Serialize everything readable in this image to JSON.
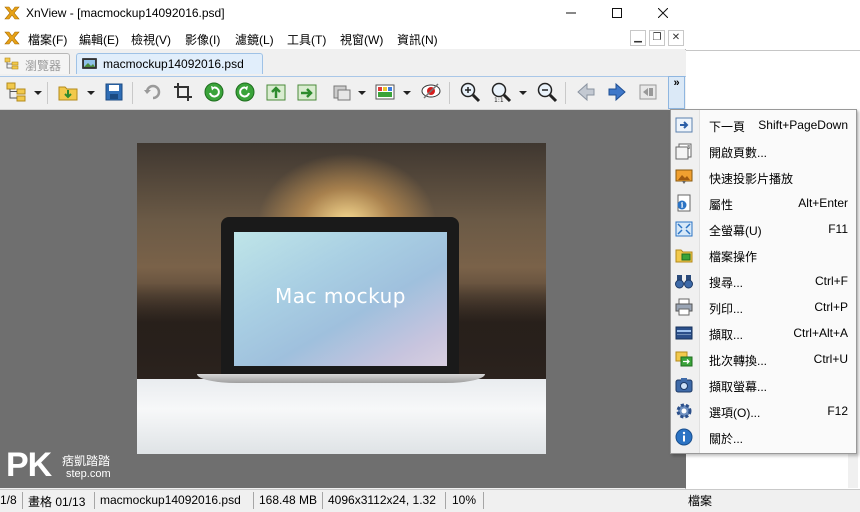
{
  "window": {
    "title": "XnView - [macmockup14092016.psd]"
  },
  "menubar": {
    "items": [
      "檔案(F)",
      "編輯(E)",
      "檢視(V)",
      "影像(I)",
      "濾鏡(L)",
      "工具(T)",
      "視窗(W)",
      "資訊(N)"
    ]
  },
  "tabs": [
    {
      "label": "瀏覽器"
    },
    {
      "label": "macmockup14092016.psd"
    }
  ],
  "image": {
    "screen_text": "Mac mockup"
  },
  "watermark": {
    "logo": "PK",
    "cn": "痞凱踏踏",
    "site": "step.com"
  },
  "statusbar": {
    "page": "1/8",
    "frame": "畫格 01/13",
    "filename": "macmockup14092016.psd",
    "size": "168.48 MB",
    "dims": "4096x3112x24, 1.32",
    "zoom": "10%"
  },
  "background_window": {
    "status": "檔案"
  },
  "dropdown_menu": {
    "items": [
      {
        "label": "下一頁",
        "shortcut": "Shift+PageDown",
        "icon": "next-page-icon"
      },
      {
        "label": "開啟頁數...",
        "shortcut": "",
        "icon": "open-pages-icon"
      },
      {
        "label": "快速投影片播放",
        "shortcut": "",
        "icon": "slideshow-icon"
      },
      {
        "label": "屬性",
        "shortcut": "Alt+Enter",
        "icon": "properties-icon"
      },
      {
        "label": "全螢幕(U)",
        "shortcut": "F11",
        "icon": "fullscreen-icon"
      },
      {
        "label": "檔案操作",
        "shortcut": "",
        "icon": "file-ops-icon"
      },
      {
        "label": "搜尋...",
        "shortcut": "Ctrl+F",
        "icon": "search-binoculars-icon"
      },
      {
        "label": "列印...",
        "shortcut": "Ctrl+P",
        "icon": "printer-icon"
      },
      {
        "label": "擷取...",
        "shortcut": "Ctrl+Alt+A",
        "icon": "scanner-icon"
      },
      {
        "label": "批次轉換...",
        "shortcut": "Ctrl+U",
        "icon": "batch-convert-icon"
      },
      {
        "label": "擷取螢幕...",
        "shortcut": "",
        "icon": "screen-capture-icon"
      },
      {
        "label": "選項(O)...",
        "shortcut": "F12",
        "icon": "options-gear-icon"
      },
      {
        "label": "關於...",
        "shortcut": "",
        "icon": "about-info-icon"
      }
    ]
  },
  "colors": {
    "accent": "#2b73c4",
    "viewer_bg": "#6f6f6f",
    "tab_active": "#e1eefb"
  }
}
